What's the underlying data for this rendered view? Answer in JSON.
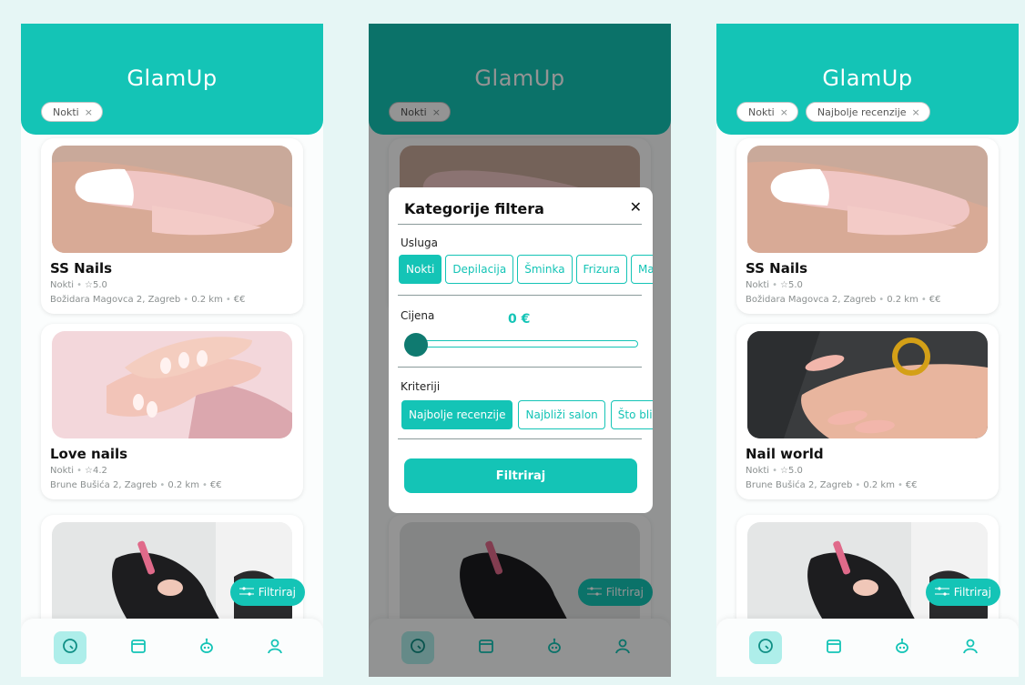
{
  "colors": {
    "accent": "#14c4b6",
    "background": "#e6f6f5"
  },
  "phones": [
    {
      "header": {
        "title": "GlamUp",
        "chips": [
          "Nokti"
        ]
      },
      "cards": [
        {
          "name": "SS Nails",
          "category": "Nokti",
          "rating": "5.0",
          "address": "Božidara Magovca 2, Zagreb",
          "distance": "0.2 km",
          "price": "€€"
        },
        {
          "name": "Love nails",
          "category": "Nokti",
          "rating": "4.2",
          "address": "Brune Bušića 2, Zagreb",
          "distance": "0.2 km",
          "price": "€€"
        }
      ],
      "filter_button": "Filtriraj"
    },
    {
      "header": {
        "title": "GlamUp",
        "chips": [
          "Nokti"
        ]
      },
      "filter_button": "Filtriraj"
    },
    {
      "header": {
        "title": "GlamUp",
        "chips": [
          "Nokti",
          "Najbolje recenzije"
        ]
      },
      "cards": [
        {
          "name": "SS Nails",
          "category": "Nokti",
          "rating": "5.0",
          "address": "Božidara Magovca 2, Zagreb",
          "distance": "0.2 km",
          "price": "€€"
        },
        {
          "name": "Nail world",
          "category": "Nokti",
          "rating": "5.0",
          "address": "Brune Bušića 2, Zagreb",
          "distance": "0.2 km",
          "price": "€€"
        }
      ],
      "filter_button": "Filtriraj"
    }
  ],
  "modal": {
    "title": "Kategorije filtera",
    "close": "✕",
    "service_label": "Usluga",
    "services": [
      "Nokti",
      "Depilacija",
      "Šminka",
      "Frizura",
      "Masaža"
    ],
    "selected_service": "Nokti",
    "price_label": "Cijena",
    "price_value": "0 €",
    "price_slider_fraction": 0,
    "criteria_label": "Kriteriji",
    "criteria": [
      "Najbolje recenzije",
      "Najbliži salon",
      "Što bliže"
    ],
    "selected_criterion": "Najbolje recenzije",
    "apply_label": "Filtriraj"
  },
  "nav": {
    "items": [
      "search-icon",
      "calendar-icon",
      "robot-icon",
      "profile-icon"
    ],
    "active": "search-icon"
  },
  "icons": {
    "chip_remove": "×",
    "star": "☆",
    "separator": "•"
  }
}
